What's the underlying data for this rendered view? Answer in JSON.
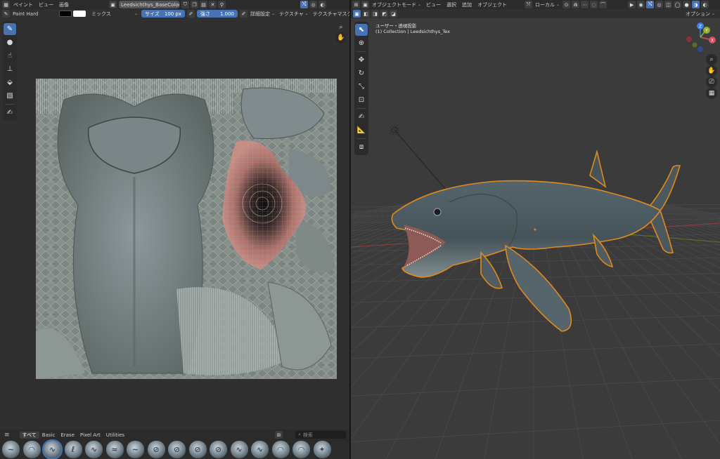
{
  "left_header": {
    "menu_paint": "ペイント",
    "menu_view": "ビュー",
    "menu_image": "画像",
    "image_name": "Leedsichthys_BaseColor.png"
  },
  "tool_header": {
    "brush_name": "Paint Hard",
    "color_primary": "#000000",
    "color_secondary": "#ffffff",
    "blend_mode": "ミックス",
    "size_label": "サイズ",
    "size_value": "100 px",
    "strength_label": "強さ",
    "strength_value": "1.000",
    "advanced_label": "詳細設定",
    "texture_label": "テクスチャ",
    "texture_mask_label": "テクスチャマスク"
  },
  "paint_tools": [
    "brush-tool",
    "blur-tool",
    "smear-tool",
    "clone-tool",
    "fill-tool",
    "mask-tool",
    "annotate-tool"
  ],
  "asset_shelf": {
    "tabs": [
      "すべて",
      "Basic",
      "Erase",
      "Pixel Art",
      "Utilities"
    ],
    "active_tab": "すべて",
    "search_placeholder": "検索",
    "brush_count": 16
  },
  "right_header": {
    "mode": "オブジェクトモード",
    "menu_view": "ビュー",
    "menu_select": "選択",
    "menu_add": "追加",
    "menu_object": "オブジェクト",
    "orientation": "ローカル",
    "options": "オプション"
  },
  "viewport": {
    "view_name": "ユーザー・透視投影",
    "collection_info": "(1) Collection | Leedsichthys_Tex",
    "gizmo_axes": [
      "X",
      "Y",
      "Z"
    ]
  },
  "colors": {
    "accent": "#4772b3",
    "selection_outline": "#e08a1e",
    "axis_x": "#d64d5b",
    "axis_y": "#8ab12f",
    "axis_z": "#3f7ee6"
  }
}
